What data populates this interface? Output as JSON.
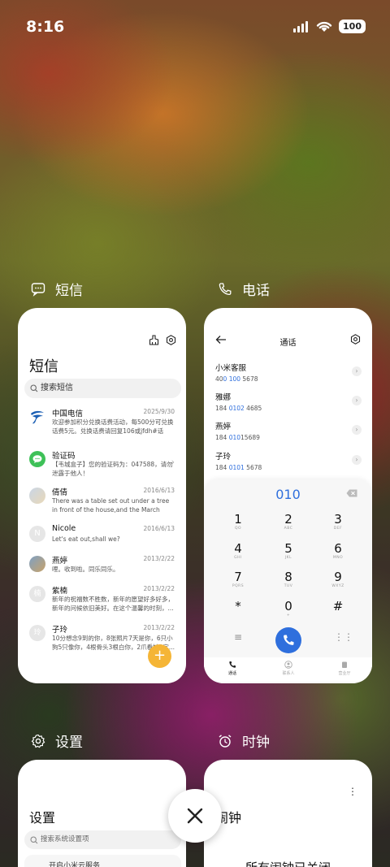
{
  "status": {
    "time": "8:16",
    "battery": "100"
  },
  "apps": {
    "sms": {
      "label": "短信",
      "title": "短信",
      "search_placeholder": "搜索短信",
      "messages": [
        {
          "name": "中国电信",
          "date": "2025/9/30",
          "preview": "欢迎参加积分兑换话费活动，每500分可兑换话费5元。兑换话费请回复106或jfdh#话费..."
        },
        {
          "name": "验证码",
          "date": "",
          "preview": "【韦城盒子】您的验证码为：047588，请勿泄露于他人！"
        },
        {
          "name": "倩倩",
          "date": "2016/6/13",
          "preview": "There was a table set out under a tree in front of the house,and the March Hare an..."
        },
        {
          "name": "Nicole",
          "date": "2016/6/13",
          "preview": "Let's eat out,shall we?"
        },
        {
          "name": "燕婷",
          "date": "2013/2/22",
          "preview": "哩。收到啦。同乐同乐。"
        },
        {
          "name": "紫楠",
          "date": "2013/2/22",
          "preview": "新年的祝福数不胜数，新年的愿望好多好多，新年的问候依旧美好。在这个温馨的时刻，..."
        },
        {
          "name": "子玲",
          "date": "2013/2/22",
          "preview": "10分想念9到的你，8张照片7天是你，6只小狗5只像你，4根骨头3根白你，2爪看她1定..."
        }
      ],
      "fab": "+"
    },
    "phone": {
      "label": "电话",
      "header_title": "通话",
      "contacts": [
        {
          "name": "小米客服",
          "num_pre": "40",
          "num_hl": "0 100",
          "num_post": " 5678"
        },
        {
          "name": "雅娜",
          "num_pre": "184 ",
          "num_hl": "0102",
          "num_post": " 4685"
        },
        {
          "name": "燕婷",
          "num_pre": "184 ",
          "num_hl": "010",
          "num_post": "15689"
        },
        {
          "name": "子玲",
          "num_pre": "184 ",
          "num_hl": "0101",
          "num_post": " 5678"
        }
      ],
      "typed": "010",
      "keys": [
        {
          "d": "1",
          "l": "QO"
        },
        {
          "d": "2",
          "l": "ABC"
        },
        {
          "d": "3",
          "l": "DEF"
        },
        {
          "d": "4",
          "l": "GHI"
        },
        {
          "d": "5",
          "l": "JKL"
        },
        {
          "d": "6",
          "l": "MNO"
        },
        {
          "d": "7",
          "l": "PQRS"
        },
        {
          "d": "8",
          "l": "TUV"
        },
        {
          "d": "9",
          "l": "WXYZ"
        },
        {
          "d": "*",
          "l": ""
        },
        {
          "d": "0",
          "l": "+"
        },
        {
          "d": "#",
          "l": ""
        }
      ],
      "nav": [
        "通话",
        "联系人",
        "营业厅"
      ]
    },
    "settings": {
      "label": "设置",
      "title": "设置",
      "search_placeholder": "搜索系统设置项",
      "row": "开启小米云服务"
    },
    "clock": {
      "label": "时钟",
      "title": "闹钟",
      "message": "所有闹钟已关闭"
    }
  }
}
